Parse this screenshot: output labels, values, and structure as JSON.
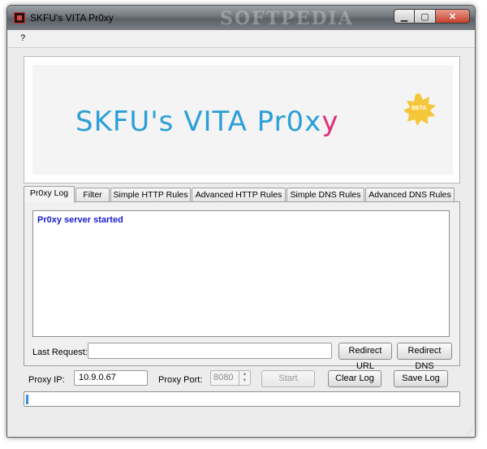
{
  "window": {
    "title": "SKFU's VITA Pr0xy",
    "watermark": "SOFTPEDIA"
  },
  "menu": {
    "help_label": "?"
  },
  "banner": {
    "text_main": "SKFU's VITA Pr0x",
    "text_y": "y",
    "badge": "BETA"
  },
  "tabs": [
    {
      "label": "Pr0xy Log",
      "active": true
    },
    {
      "label": "Filter",
      "active": false
    },
    {
      "label": "Simple HTTP Rules",
      "active": false
    },
    {
      "label": "Advanced HTTP Rules",
      "active": false
    },
    {
      "label": "Simple DNS Rules",
      "active": false
    },
    {
      "label": "Advanced DNS Rules",
      "active": false
    }
  ],
  "log": {
    "lines": [
      "Pr0xy server started"
    ]
  },
  "last_request": {
    "label": "Last Request:",
    "value": ""
  },
  "buttons": {
    "redirect_url": "Redirect URL",
    "redirect_dns": "Redirect DNS",
    "start": "Start",
    "clear_log": "Clear Log",
    "save_log": "Save Log"
  },
  "proxy": {
    "ip_label": "Proxy IP:",
    "ip_value": "10.9.0.67",
    "port_label": "Proxy Port:",
    "port_value": "8080"
  },
  "progress": {
    "value": 0
  },
  "colors": {
    "log_text": "#1a1ad0",
    "banner_blue": "#2a9fd8",
    "banner_pink": "#e0307a"
  }
}
